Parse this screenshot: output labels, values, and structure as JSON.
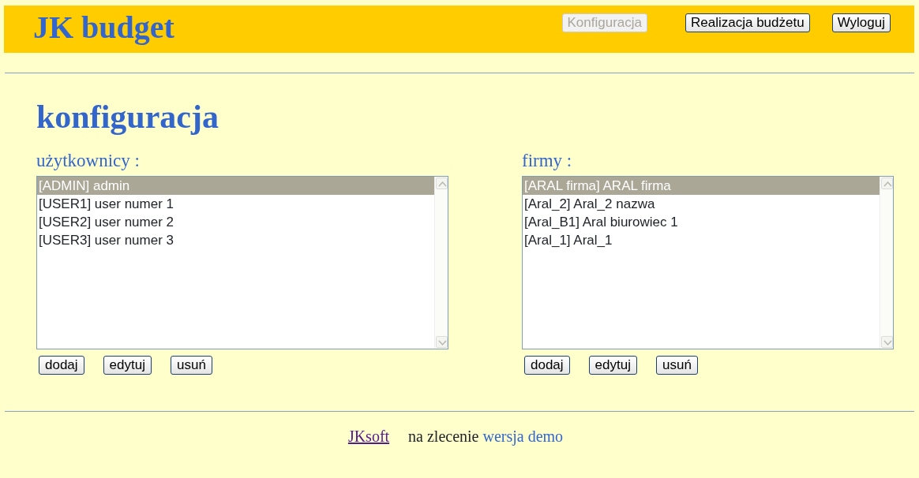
{
  "header": {
    "logo": "JK budget",
    "nav": [
      {
        "label": "Konfiguracja",
        "disabled": true
      },
      {
        "label": "Realizacja budżetu",
        "disabled": false
      },
      {
        "label": "Wyloguj",
        "disabled": false
      }
    ]
  },
  "page_title": "konfiguracja",
  "panels": [
    {
      "label": "użytkownicy :",
      "items": [
        {
          "text": "[ADMIN] admin",
          "selected": true
        },
        {
          "text": "[USER1] user numer 1",
          "selected": false
        },
        {
          "text": "[USER2] user numer 2",
          "selected": false
        },
        {
          "text": "[USER3] user numer 3",
          "selected": false
        }
      ],
      "buttons": [
        "dodaj",
        "edytuj",
        "usuń"
      ]
    },
    {
      "label": "firmy :",
      "items": [
        {
          "text": "[ARAL firma] ARAL firma",
          "selected": true
        },
        {
          "text": "[Aral_2] Aral_2 nazwa",
          "selected": false
        },
        {
          "text": "[Aral_B1] Aral biurowiec 1",
          "selected": false
        },
        {
          "text": "[Aral_1] Aral_1",
          "selected": false
        }
      ],
      "buttons": [
        "dodaj",
        "edytuj",
        "usuń"
      ]
    }
  ],
  "footer": {
    "link": "JKsoft",
    "text": "na zlecenie",
    "note": "wersja demo"
  }
}
